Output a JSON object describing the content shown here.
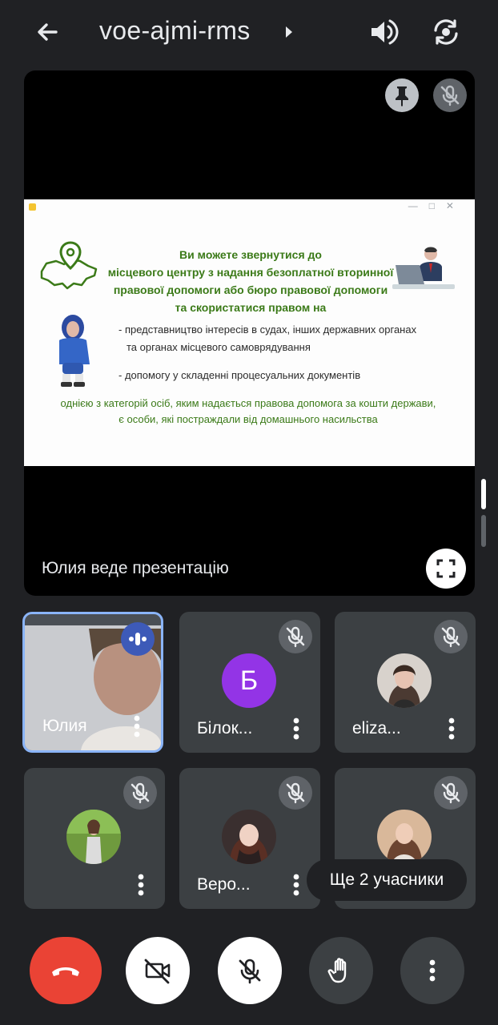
{
  "header": {
    "meeting_code": "voe-ajmi-rms",
    "back_icon": "arrow-left-icon",
    "speaker_icon": "volume-icon",
    "switch_camera_icon": "switch-camera-icon"
  },
  "stage": {
    "presenting_label": "Юлия веде презентацію",
    "slide": {
      "heading_lines": [
        "Ви можете звернутися до",
        "місцевого центру з надання безоплатної вторинної",
        "правової допомоги або бюро правової допомоги",
        "та скористатися правом на"
      ],
      "bullet1_line1": "- представництво інтересів в судах, інших державних органах",
      "bullet1_line2": "та органах місцевого самоврядування",
      "bullet2": "- допомогу у складенні процесуальних документів",
      "footer_line1": "однією з категорій осіб, яким надається правова допомога за кошти держави,",
      "footer_line2": "є особи, які постраждали від домашнього насильства"
    }
  },
  "participants": [
    {
      "name": "Юлия",
      "state": "speaking"
    },
    {
      "name": "Білок...",
      "initial": "Б",
      "state": "muted"
    },
    {
      "name": "eliza...",
      "state": "muted"
    },
    {
      "name": "",
      "state": "muted"
    },
    {
      "name": "Веро...",
      "state": "muted"
    },
    {
      "name": "",
      "state": "muted"
    }
  ],
  "more_participants_label": "Ще 2 учасники",
  "colors": {
    "background": "#202124",
    "tile": "#3c4043",
    "hangup": "#ea4335",
    "active_border": "#8ab4f8",
    "slide_green": "#3b7a18",
    "avatar_purple": "#9334e6"
  }
}
